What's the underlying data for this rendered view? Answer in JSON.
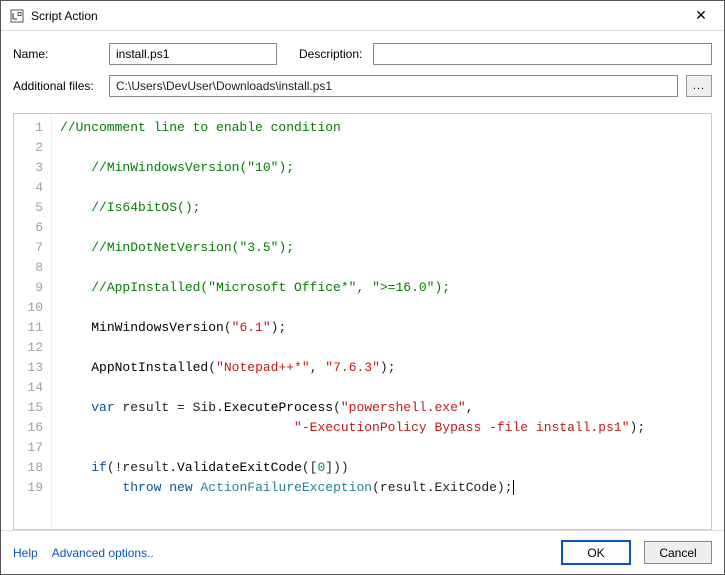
{
  "window": {
    "title": "Script Action",
    "close_glyph": "✕"
  },
  "form": {
    "name_label": "Name:",
    "name_value": "install.ps1",
    "desc_label": "Description:",
    "desc_value": "",
    "addfiles_label": "Additional files:",
    "addfiles_value": "C:\\Users\\DevUser\\Downloads\\install.ps1",
    "browse_label": "..."
  },
  "code_lines": [
    {
      "n": 1,
      "spans": [
        [
          "com",
          "//Uncomment line to enable condition"
        ]
      ]
    },
    {
      "n": 2,
      "spans": []
    },
    {
      "n": 3,
      "spans": [
        [
          "ind",
          "    "
        ],
        [
          "com",
          "//MinWindowsVersion(\"10\");"
        ]
      ]
    },
    {
      "n": 4,
      "spans": []
    },
    {
      "n": 5,
      "spans": [
        [
          "ind",
          "    "
        ],
        [
          "com",
          "//Is64bitOS();"
        ]
      ]
    },
    {
      "n": 6,
      "spans": []
    },
    {
      "n": 7,
      "spans": [
        [
          "ind",
          "    "
        ],
        [
          "com",
          "//MinDotNetVersion(\"3.5\");"
        ]
      ]
    },
    {
      "n": 8,
      "spans": []
    },
    {
      "n": 9,
      "spans": [
        [
          "ind",
          "    "
        ],
        [
          "com",
          "//AppInstalled(\"Microsoft Office*\", \">=16.0\");"
        ]
      ]
    },
    {
      "n": 10,
      "spans": []
    },
    {
      "n": 11,
      "spans": [
        [
          "ind",
          "    "
        ],
        [
          "fn",
          "MinWindowsVersion"
        ],
        [
          "txt",
          "("
        ],
        [
          "str",
          "\"6.1\""
        ],
        [
          "txt",
          ");"
        ]
      ]
    },
    {
      "n": 12,
      "spans": []
    },
    {
      "n": 13,
      "spans": [
        [
          "ind",
          "    "
        ],
        [
          "fn",
          "AppNotInstalled"
        ],
        [
          "txt",
          "("
        ],
        [
          "str",
          "\"Notepad++*\""
        ],
        [
          "txt",
          ", "
        ],
        [
          "str",
          "\"7.6.3\""
        ],
        [
          "txt",
          ");"
        ]
      ]
    },
    {
      "n": 14,
      "spans": []
    },
    {
      "n": 15,
      "spans": [
        [
          "ind",
          "    "
        ],
        [
          "kw",
          "var"
        ],
        [
          "txt",
          " result = Sib."
        ],
        [
          "fn",
          "ExecuteProcess"
        ],
        [
          "txt",
          "("
        ],
        [
          "str",
          "\"powershell.exe\""
        ],
        [
          "txt",
          ","
        ]
      ]
    },
    {
      "n": 16,
      "spans": [
        [
          "ind",
          "                              "
        ],
        [
          "str",
          "\"-ExecutionPolicy Bypass -file install.ps1\""
        ],
        [
          "txt",
          ");"
        ]
      ]
    },
    {
      "n": 17,
      "spans": []
    },
    {
      "n": 18,
      "spans": [
        [
          "ind",
          "    "
        ],
        [
          "kw",
          "if"
        ],
        [
          "txt",
          "(!result."
        ],
        [
          "fn",
          "ValidateExitCode"
        ],
        [
          "txt",
          "(["
        ],
        [
          "num",
          "0"
        ],
        [
          "txt",
          "]))"
        ]
      ]
    },
    {
      "n": 19,
      "spans": [
        [
          "ind",
          "        "
        ],
        [
          "kw",
          "throw"
        ],
        [
          "txt",
          " "
        ],
        [
          "kw",
          "new"
        ],
        [
          "txt",
          " "
        ],
        [
          "cls",
          "ActionFailureException"
        ],
        [
          "txt",
          "(result.ExitCode);"
        ]
      ],
      "caret": true
    }
  ],
  "footer": {
    "help": "Help",
    "advanced": "Advanced options..",
    "ok": "OK",
    "cancel": "Cancel"
  }
}
